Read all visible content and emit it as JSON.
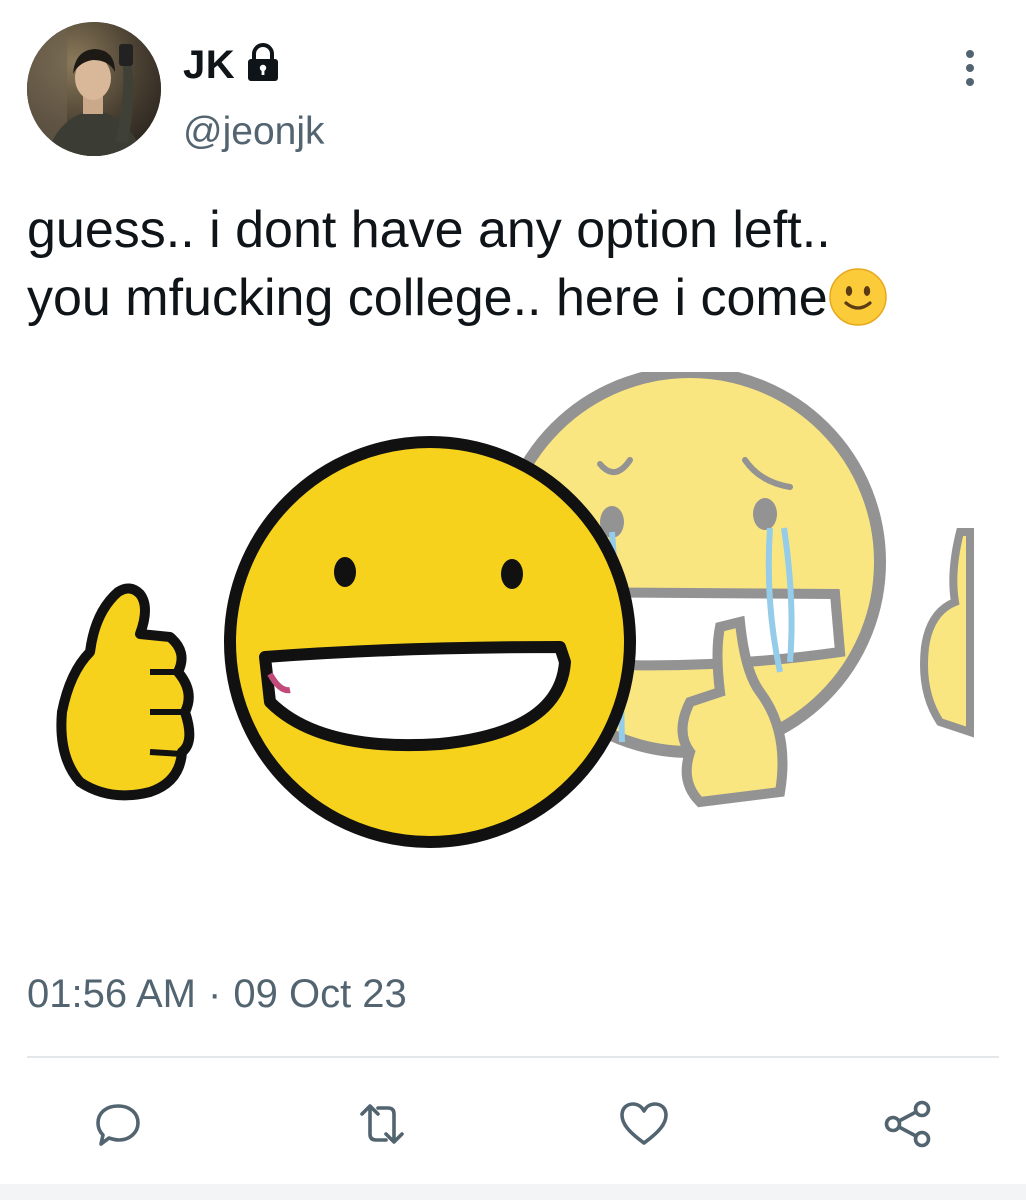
{
  "author": {
    "display_name": "JK",
    "handle": "@jeonjk",
    "protected": true,
    "avatar": "profile-photo"
  },
  "tweet": {
    "text_lines": [
      "guess.. i dont have any option left..",
      "you mfucking college.. here i come"
    ],
    "trailing_emoji": "slightly-smiling-face",
    "media": "smiling-emoji-thumbs-up-fading-to-crying-emoji-meme"
  },
  "meta": {
    "time": "01:56 AM",
    "separator": "·",
    "date": "09 Oct 23"
  },
  "actions": [
    {
      "name": "reply",
      "icon": "speech-bubble-icon"
    },
    {
      "name": "retweet",
      "icon": "retweet-icon"
    },
    {
      "name": "like",
      "icon": "heart-icon"
    },
    {
      "name": "share",
      "icon": "share-icon"
    }
  ],
  "colors": {
    "text_primary": "#0f1419",
    "text_secondary": "#536471",
    "divider": "#e3e7ea",
    "emoji_yellow": "#f7d21c"
  }
}
